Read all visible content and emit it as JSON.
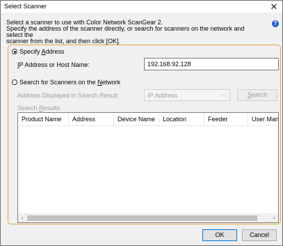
{
  "window": {
    "title": "Select Scanner"
  },
  "intro": {
    "line1": "Select a scanner to use with Color Network ScanGear 2.",
    "line2": "Specify the address of the scanner directly, or search for scanners on the network and select the",
    "line3": "scanner from the list, and then click [OK]."
  },
  "specify": {
    "label_pre": "Specify ",
    "label_key": "A",
    "label_post": "ddress",
    "checked": true,
    "ip_label_key": "I",
    "ip_label_rest": "P Address or Host Name:",
    "ip_value": "192.168.92.128"
  },
  "search": {
    "label_pre": "Search for Scanners on the ",
    "label_key": "N",
    "label_post": "etwork",
    "checked": false,
    "address_label": "Address Displayed in Search Result:",
    "address_option": "IP Address",
    "search_key": "S",
    "search_rest": "earch",
    "results_label_pre": "Search ",
    "results_label_key": "R",
    "results_label_post": "esults:"
  },
  "results_columns": [
    "Product Name",
    "Address",
    "Device Name",
    "Location",
    "Feeder",
    "User Man"
  ],
  "buttons": {
    "ok": "OK",
    "cancel": "Cancel"
  },
  "icons": {
    "close": "close-icon",
    "help": "help-icon",
    "chevron": "chevron-down-icon",
    "scroll_left": "scroll-left-icon",
    "scroll_right": "scroll-right-icon"
  },
  "colors": {
    "group_border": "#e8a53a",
    "help_icon": "#1b5fd1"
  }
}
